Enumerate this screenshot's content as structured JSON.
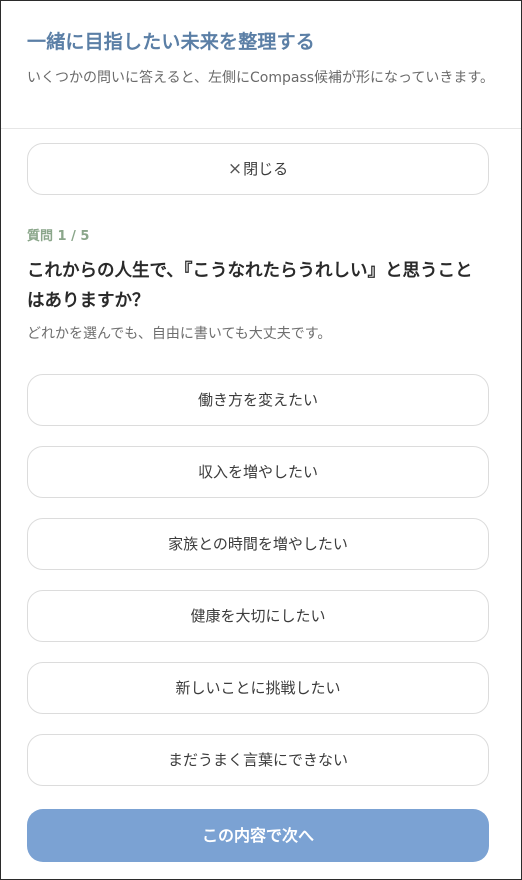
{
  "header": {
    "title": "一緒に目指したい未来を整理する",
    "subtitle": "いくつかの問いに答えると、左側にCompass候補が形になっていきます。"
  },
  "close_button": {
    "icon": "×",
    "label": "閉じる"
  },
  "question": {
    "step": "質問 1 / 5",
    "text": "これからの人生で、『こうなれたらうれしい』と思うことはありますか？",
    "hint": "どれかを選んでも、自由に書いても大丈夫です。"
  },
  "options": [
    {
      "label": "働き方を変えたい"
    },
    {
      "label": "収入を増やしたい"
    },
    {
      "label": "家族との時間を増やしたい"
    },
    {
      "label": "健康を大切にしたい"
    },
    {
      "label": "新しいことに挑戦したい"
    },
    {
      "label": "まだうまく言葉にできない"
    }
  ],
  "next_button": {
    "label": "この内容で次へ"
  },
  "colors": {
    "title": "#5b7fa6",
    "step": "#8aa68a",
    "primary_button": "#7ba2d3"
  }
}
